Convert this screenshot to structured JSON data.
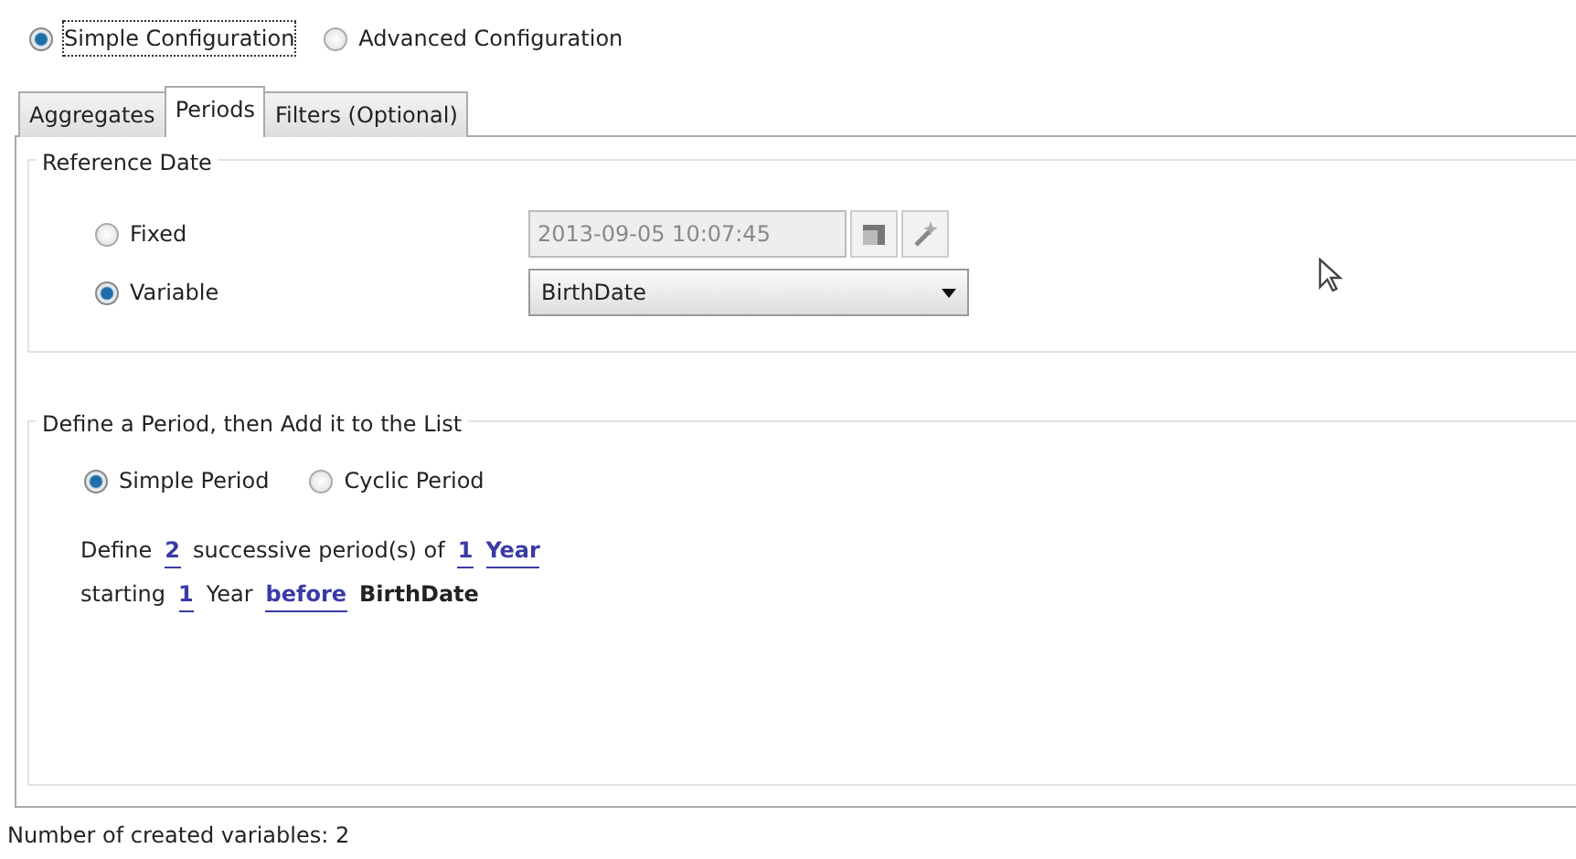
{
  "config_modes": [
    {
      "label": "Simple Configuration",
      "selected": true
    },
    {
      "label": "Advanced Configuration",
      "selected": false
    }
  ],
  "tabs": [
    {
      "label": "Aggregates",
      "selected": false
    },
    {
      "label": "Periods",
      "selected": true
    },
    {
      "label": "Filters (Optional)",
      "selected": false
    }
  ],
  "reference_date": {
    "title": "Reference Date",
    "options": [
      {
        "label": "Fixed",
        "selected": false,
        "kind": "datetime",
        "value": "2013-09-05 10:07:45",
        "disabled": true
      },
      {
        "label": "Variable",
        "selected": true,
        "kind": "dropdown",
        "value": "BirthDate"
      }
    ]
  },
  "period": {
    "title": "Define a Period, then Add it to the List",
    "types": [
      {
        "label": "Simple Period",
        "selected": true
      },
      {
        "label": "Cyclic Period",
        "selected": false
      }
    ],
    "lines": [
      [
        {
          "kind": "text",
          "text": "Define"
        },
        {
          "kind": "link",
          "text": "2"
        },
        {
          "kind": "text",
          "text": "successive period(s) of"
        },
        {
          "kind": "link",
          "text": "1"
        },
        {
          "kind": "link",
          "text": "Year"
        }
      ],
      [
        {
          "kind": "text",
          "text": "starting"
        },
        {
          "kind": "link",
          "text": "1"
        },
        {
          "kind": "text",
          "text": "Year"
        },
        {
          "kind": "link",
          "text": "before"
        },
        {
          "kind": "bold",
          "text": "BirthDate"
        }
      ]
    ]
  },
  "status_bar": "Number of created variables: 2"
}
